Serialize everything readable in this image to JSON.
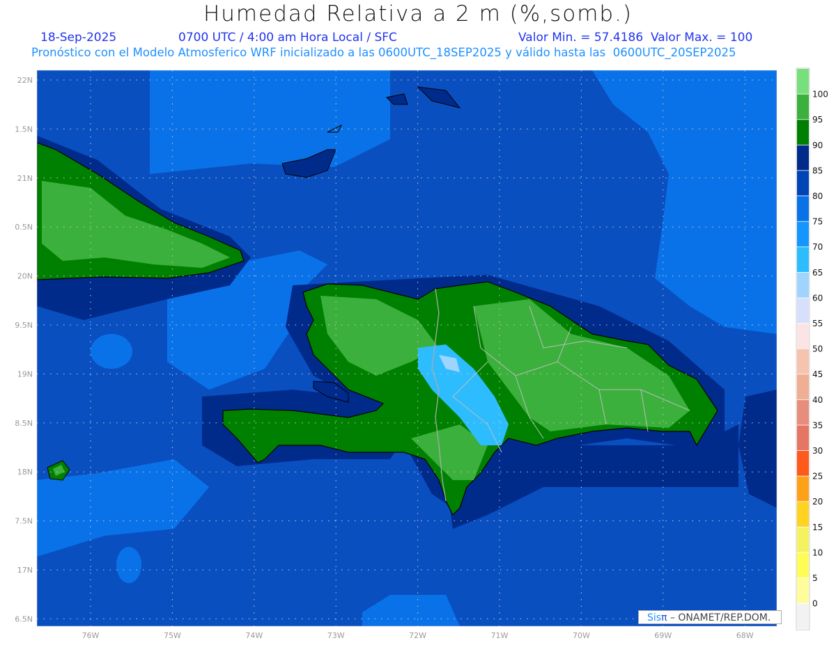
{
  "title": "Humedad Relativa a 2 m (%,somb.)",
  "header": {
    "date": "18-Sep-2025",
    "time": "0700 UTC / 4:00 am Hora Local / SFC",
    "min_max": "Valor Min. = 57.4186  Valor Max. = 100",
    "model_info": "Pronóstico con el Modelo Atmosferico WRF inicializado a las 0600UTC_18SEP2025 y válido hasta las  0600UTC_20SEP2025"
  },
  "map": {
    "lat_labels": [
      "22N",
      "1.5N",
      "21N",
      "0.5N",
      "20N",
      "9.5N",
      "19N",
      "8.5N",
      "18N",
      "7.5N",
      "17N",
      "6.5N"
    ],
    "lon_labels": [
      "76W",
      "75W",
      "74W",
      "73W",
      "72W",
      "71W",
      "70W",
      "69W",
      "68W"
    ],
    "colors": {
      "ocean": "#0a4fc0",
      "ocean_light": "#0a72e8",
      "ocean_dark": "#002b8b",
      "land_dark": "#008000",
      "land": "#3cb03c",
      "dry": "#2dbdff"
    }
  },
  "legend": {
    "labels": [
      "100",
      "95",
      "90",
      "85",
      "80",
      "75",
      "70",
      "65",
      "60",
      "55",
      "50",
      "45",
      "40",
      "35",
      "30",
      "25",
      "20",
      "15",
      "10",
      "5",
      "0"
    ],
    "colors": [
      "#77e07a",
      "#3cb03c",
      "#008000",
      "#002b8b",
      "#0045b5",
      "#0a72e8",
      "#1495ff",
      "#2dbdff",
      "#9fd4ff",
      "#d6e0fc",
      "#fde4e4",
      "#f6c3ae",
      "#f0ae93",
      "#e88d7b",
      "#e67664",
      "#ff5a1c",
      "#ffa117",
      "#ffd31f",
      "#f5f260",
      "#fffc56",
      "#fffd9a",
      "#f2f2f2"
    ]
  },
  "credit": {
    "sis": "Sis",
    "pi": "π",
    "org": " – ONAMET/REP.DOM."
  }
}
